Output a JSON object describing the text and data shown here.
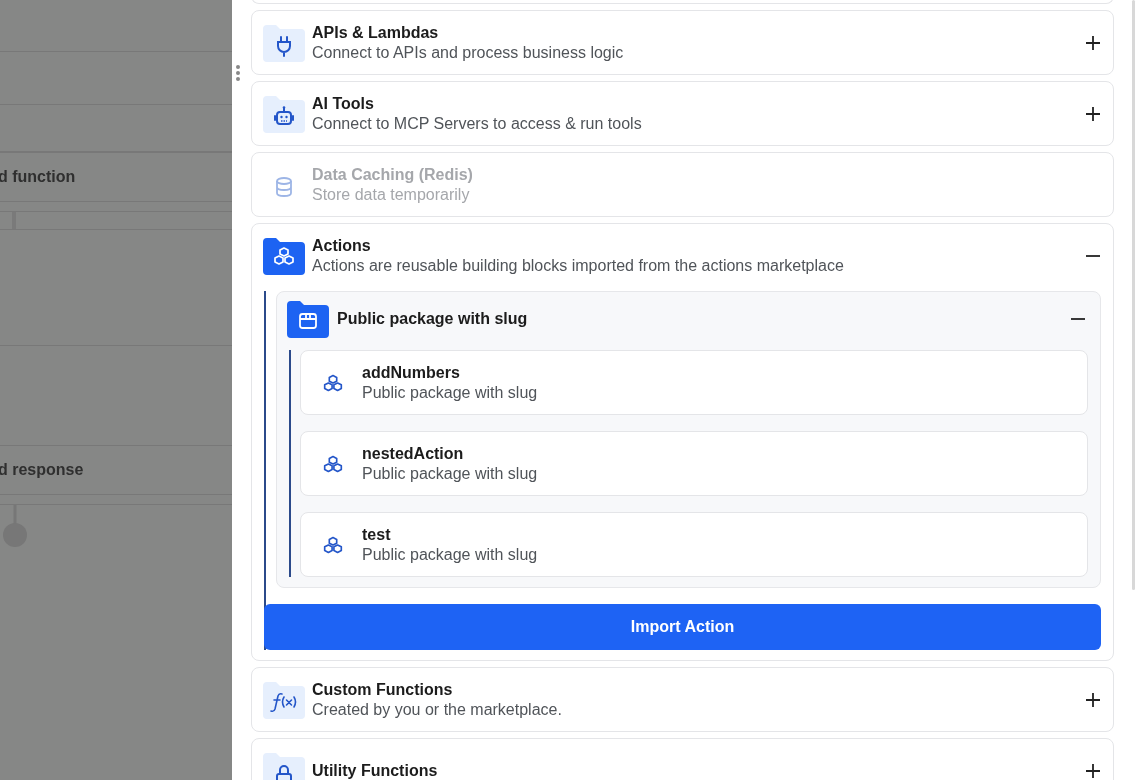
{
  "canvas": {
    "nodes": [
      {
        "label": "d function"
      },
      {
        "label": "d response"
      }
    ]
  },
  "panel": {
    "sections": [
      {
        "title": "APIs & Lambdas",
        "description": "Connect to APIs and process business logic",
        "disabled": false,
        "expanded": false
      },
      {
        "title": "AI Tools",
        "description": "Connect to MCP Servers to access & run tools",
        "disabled": false,
        "expanded": false
      },
      {
        "title": "Data Caching (Redis)",
        "description": "Store data temporarily",
        "disabled": true,
        "expanded": false
      },
      {
        "title": "Actions",
        "description": "Actions are reusable building blocks imported from the actions marketplace",
        "disabled": false,
        "expanded": true,
        "packages": [
          {
            "title": "Public package with slug",
            "expanded": true,
            "actions": [
              {
                "name": "addNumbers",
                "description": "Public package with slug"
              },
              {
                "name": "nestedAction",
                "description": "Public package with slug"
              },
              {
                "name": "test",
                "description": "Public package with slug"
              }
            ]
          }
        ],
        "button": "Import Action"
      },
      {
        "title": "Custom Functions",
        "description": "Created by you or the marketplace.",
        "disabled": false,
        "expanded": false
      },
      {
        "title": "Utility Functions",
        "disabled": false,
        "expanded": false
      }
    ]
  }
}
